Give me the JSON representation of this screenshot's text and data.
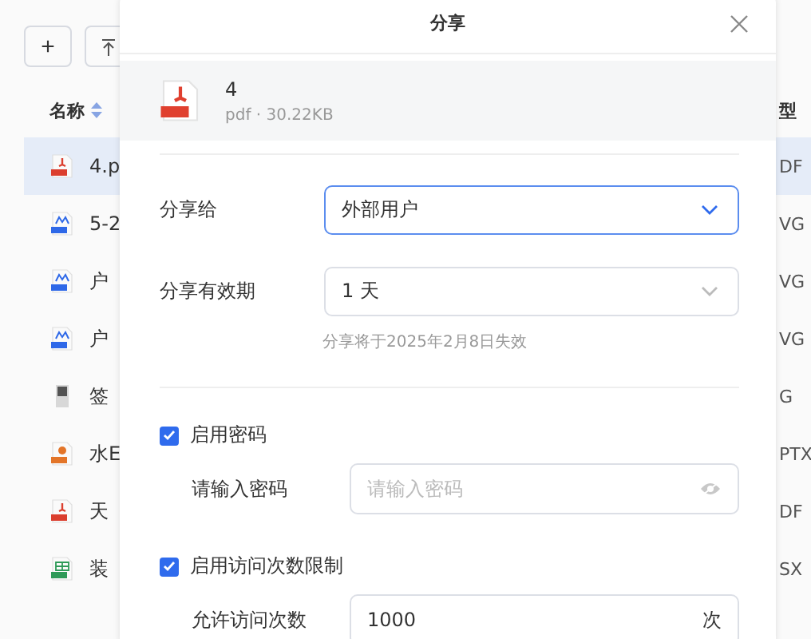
{
  "toolbar": {
    "add_button": "+"
  },
  "list": {
    "name_header": "名称",
    "type_header": "型",
    "rows": [
      {
        "kind": "pdf",
        "name": "4.p",
        "type": "DF",
        "selected": true
      },
      {
        "kind": "dwg",
        "name": "5-2",
        "type": "VG",
        "selected": false
      },
      {
        "kind": "dwg",
        "name": "户",
        "type": "VG",
        "selected": false
      },
      {
        "kind": "dwg",
        "name": "户",
        "type": "VG",
        "selected": false
      },
      {
        "kind": "img",
        "name": "签",
        "type": "G",
        "selected": false
      },
      {
        "kind": "ppt",
        "name": "水E",
        "type": "PTX",
        "selected": false
      },
      {
        "kind": "pdf",
        "name": "天",
        "type": "DF",
        "selected": false
      },
      {
        "kind": "xlsx",
        "name": "装",
        "type": "SX",
        "selected": false
      }
    ]
  },
  "dialog": {
    "title": "分享",
    "file": {
      "kind": "pdf",
      "name": "4",
      "meta": "pdf · 30.22KB"
    },
    "share_to": {
      "label": "分享给",
      "value": "外部用户"
    },
    "validity": {
      "label": "分享有效期",
      "value": "1 天",
      "hint": "分享将于2025年2月8日失效"
    },
    "password": {
      "checkbox": "启用密码",
      "checked": true,
      "label": "请输入密码",
      "placeholder": "请输入密码"
    },
    "visit_limit": {
      "checkbox": "启用访问次数限制",
      "checked": true,
      "label": "允许访问次数",
      "value": "1000",
      "suffix": "次"
    }
  }
}
